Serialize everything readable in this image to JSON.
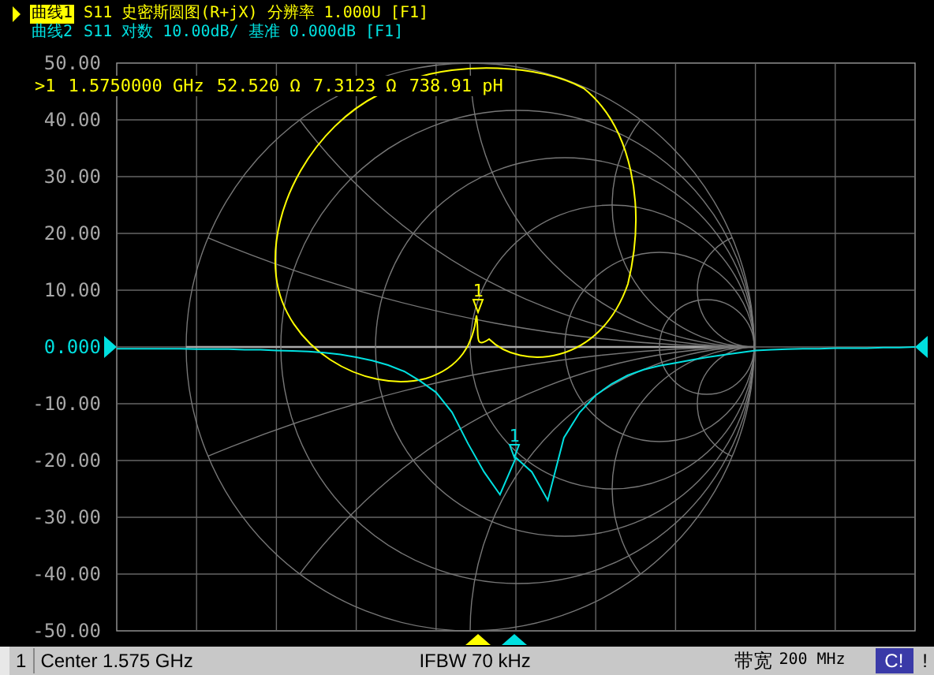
{
  "traces": [
    {
      "label": "曲线1",
      "selected": true,
      "text": "S11 史密斯圆图(R+jX) 分辨率 1.000U [F1]",
      "color": "#ffff00"
    },
    {
      "label": "曲线2",
      "selected": false,
      "text": "S11 对数 10.00dB/ 基准 0.000dB [F1]",
      "color": "#00e0e0"
    }
  ],
  "chart_data": {
    "type": "line",
    "ylim": [
      -50,
      50
    ],
    "yticks": [
      {
        "value": 50,
        "label": "50.00"
      },
      {
        "value": 40,
        "label": "40.00"
      },
      {
        "value": 30,
        "label": "30.00"
      },
      {
        "value": 20,
        "label": "20.00"
      },
      {
        "value": 10,
        "label": "10.00"
      },
      {
        "value": 0,
        "label": "0.000"
      },
      {
        "value": -10,
        "label": "-10.00"
      },
      {
        "value": -20,
        "label": "-20.00"
      },
      {
        "value": -30,
        "label": "-30.00"
      },
      {
        "value": -40,
        "label": "-40.00"
      },
      {
        "value": -50,
        "label": "-50.00"
      }
    ],
    "series": [
      {
        "color": "#00e0e0",
        "values": [
          -0.3,
          -0.3,
          -0.3,
          -0.3,
          -0.3,
          -0.4,
          -0.4,
          -0.4,
          -0.5,
          -0.5,
          -0.6,
          -0.7,
          -0.8,
          -1.0,
          -1.3,
          -1.8,
          -2.4,
          -3.2,
          -4.3,
          -6.0,
          -8.0,
          -11.5,
          -17.0,
          -22.0,
          -26.0,
          -19.5,
          -22.0,
          -27.0,
          -16.0,
          -11.5,
          -8.5,
          -6.5,
          -5.0,
          -4.0,
          -3.3,
          -2.8,
          -2.3,
          -1.8,
          -1.4,
          -1.0,
          -0.6,
          -0.5,
          -0.4,
          -0.3,
          -0.3,
          -0.2,
          -0.2,
          -0.2,
          -0.1,
          -0.1,
          0.0
        ]
      }
    ],
    "ref_lines": [
      {
        "axis": "y",
        "value": 0
      }
    ],
    "grid": true
  },
  "marker_readout": {
    "index": ">1",
    "frequency": "1.5750000 GHz",
    "resistance": "52.520 Ω",
    "reactance": "7.3123 Ω",
    "inductance": "738.91 pH"
  },
  "markers": [
    {
      "label": "1",
      "color": "#ffff00"
    },
    {
      "label": "1",
      "color": "#00e0e0"
    }
  ],
  "status_bar": {
    "channel": "1",
    "center": "Center 1.575 GHz",
    "ifbw": "IFBW 70 kHz",
    "bandwidth_label": "带宽",
    "bandwidth_value": "200 MHz",
    "cal_badge": "C!",
    "warning": "!"
  }
}
